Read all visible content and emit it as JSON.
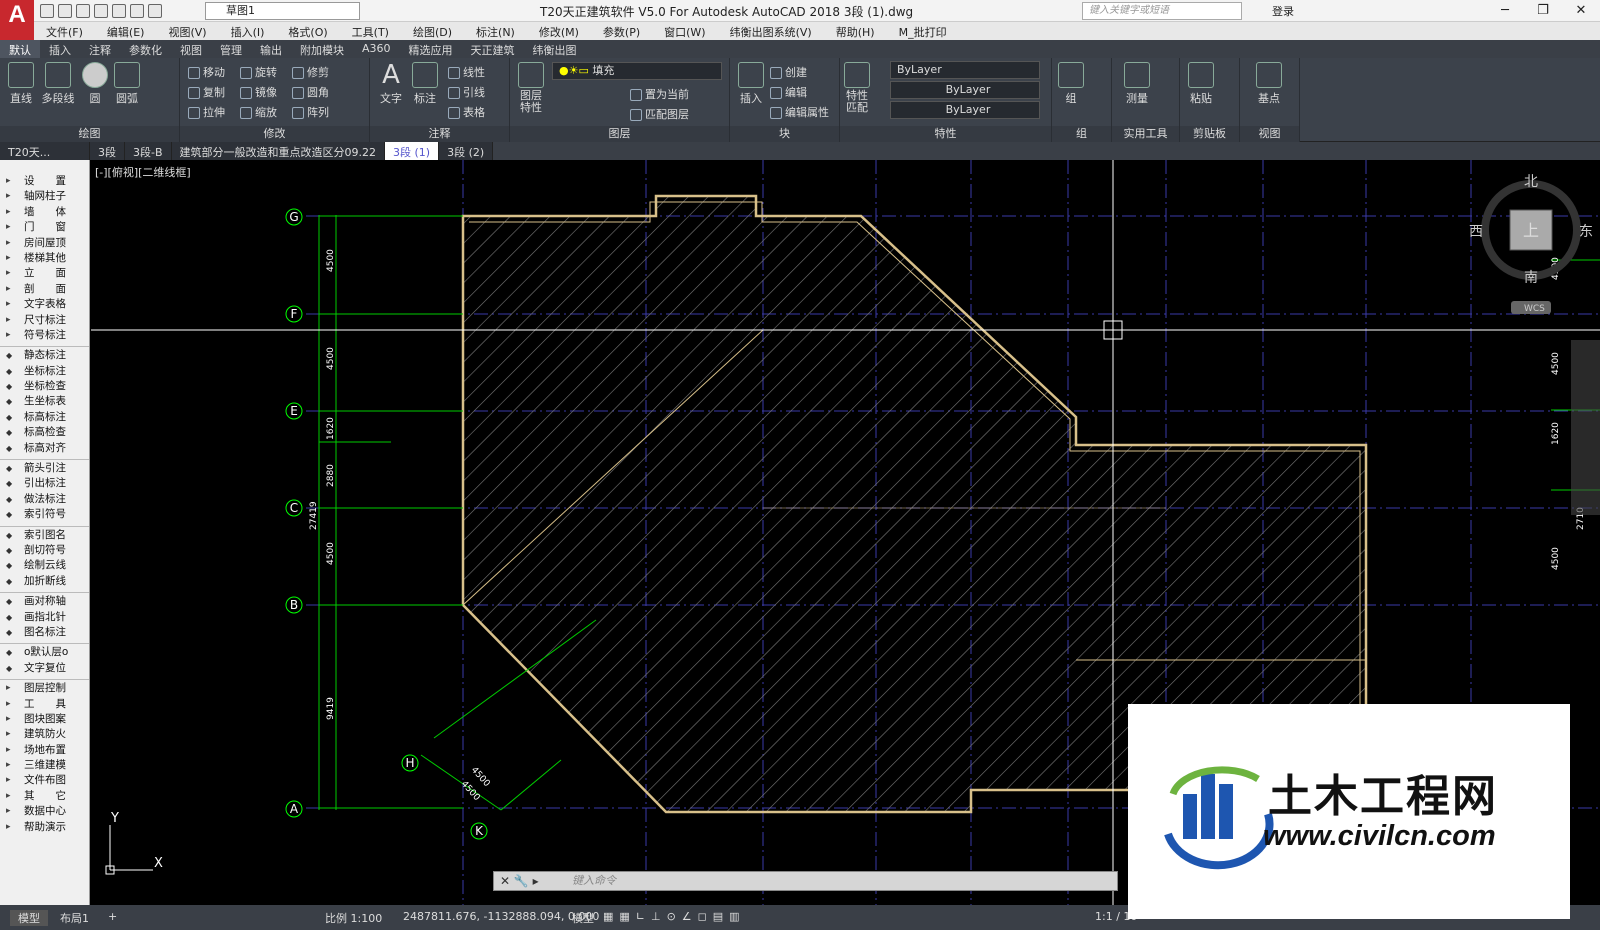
{
  "app": {
    "title": "T20天正建筑软件 V5.0 For Autodesk AutoCAD 2018     3段 (1).dwg",
    "logo": "A",
    "workspace": "草图1",
    "search_placeholder": "键入关键字或短语",
    "login": "登录"
  },
  "menus": [
    "文件(F)",
    "编辑(E)",
    "视图(V)",
    "插入(I)",
    "格式(O)",
    "工具(T)",
    "绘图(D)",
    "标注(N)",
    "修改(M)",
    "参数(P)",
    "窗口(W)",
    "纬衡出图系统(V)",
    "帮助(H)",
    "M_批打印"
  ],
  "ribbon_tabs": [
    "默认",
    "插入",
    "注释",
    "参数化",
    "视图",
    "管理",
    "输出",
    "附加模块",
    "A360",
    "精选应用",
    "天正建筑",
    "纬衡出图"
  ],
  "ribbon": {
    "draw": {
      "label": "绘图",
      "line": "直线",
      "polyline": "多段线",
      "circle": "圆",
      "arc": "圆弧"
    },
    "modify": {
      "label": "修改",
      "move": "移动",
      "rotate": "旋转",
      "trim": "修剪",
      "copy": "复制",
      "mirror": "镜像",
      "fillet": "圆角",
      "stretch": "拉伸",
      "scale": "缩放",
      "array": "阵列"
    },
    "annotation": {
      "label": "注释",
      "text": "文字",
      "dimension": "标注",
      "linear": "线性",
      "leader": "引线",
      "table": "表格"
    },
    "layers": {
      "label": "图层",
      "properties": "图层特性",
      "fill": "填充",
      "set_current": "置为当前",
      "match": "匹配图层"
    },
    "block": {
      "label": "块",
      "insert": "插入",
      "create": "创建",
      "edit": "编辑",
      "edit_attr": "编辑属性"
    },
    "properties": {
      "label": "特性",
      "match": "特性匹配",
      "color": "ByLayer",
      "linetype": "ByLayer",
      "lineweight": "ByLayer"
    },
    "groups": {
      "label": "组",
      "group": "组"
    },
    "utilities": {
      "label": "实用工具",
      "measure": "测量"
    },
    "clipboard": {
      "label": "剪贴板",
      "paste": "粘贴"
    },
    "view": {
      "label": "视图",
      "base": "基点"
    }
  },
  "doc_tabs": [
    "T20天...",
    "3段",
    "3段-B",
    "建筑部分一般改造和重点改造区分09.22",
    "3段 (1)",
    "3段 (2)"
  ],
  "active_doc_tab": 4,
  "viewport_label": "[-][俯视][二维线框]",
  "palette": {
    "group1": [
      "设　　置",
      "轴网柱子",
      "墙　　体",
      "门　　窗",
      "房间屋顶",
      "楼梯其他",
      "立　　面",
      "剖　　面",
      "文字表格",
      "尺寸标注",
      "符号标注"
    ],
    "group2": [
      "静态标注",
      "坐标标注",
      "坐标检查",
      "生坐标表",
      "标高标注",
      "标高检查",
      "标高对齐"
    ],
    "group3": [
      "箭头引注",
      "引出标注",
      "做法标注",
      "索引符号"
    ],
    "group4": [
      "索引图名",
      "剖切符号",
      "绘制云线",
      "加折断线"
    ],
    "group5": [
      "画对称轴",
      "画指北针",
      "图名标注"
    ],
    "group6": [
      "o默认层o",
      "文字复位"
    ],
    "group7": [
      "图层控制",
      "工　　具",
      "图块图案",
      "建筑防火",
      "场地布置",
      "三维建模",
      "文件布图",
      "其　　它",
      "数据中心",
      "帮助演示"
    ]
  },
  "axes": {
    "grid_labels": [
      "G",
      "F",
      "E",
      "C",
      "B",
      "A",
      "H",
      "K"
    ],
    "dims_left": [
      "4500",
      "4500",
      "1620",
      "2880",
      "4500",
      "9419"
    ],
    "dim_total": "27419",
    "dims_diag": [
      "4500",
      "4500"
    ],
    "dims_right": [
      "4500",
      "4500",
      "1620",
      "4500",
      "2710"
    ]
  },
  "viewcube": {
    "north": "北",
    "south": "南",
    "east": "东",
    "west": "西",
    "top": "上",
    "wcs": "WCS"
  },
  "ucs": {
    "x": "X",
    "y": "Y"
  },
  "command": {
    "placeholder": "键入命令"
  },
  "status": {
    "model_tab": "模型",
    "layout_tab": "布局1",
    "scale": "比例 1:100",
    "coords": "2487811.676, -1132888.094, 0.000",
    "mode": "模型",
    "anno_scale": "1:1 / 10"
  },
  "watermark": {
    "text": "土木工程网",
    "url": "www.civilcn.com"
  },
  "colors": {
    "hatch_outline": "#d8c08a",
    "axis_line": "#3a3aa8",
    "dim_green": "#00ff00",
    "crosshair": "#ffffff"
  }
}
